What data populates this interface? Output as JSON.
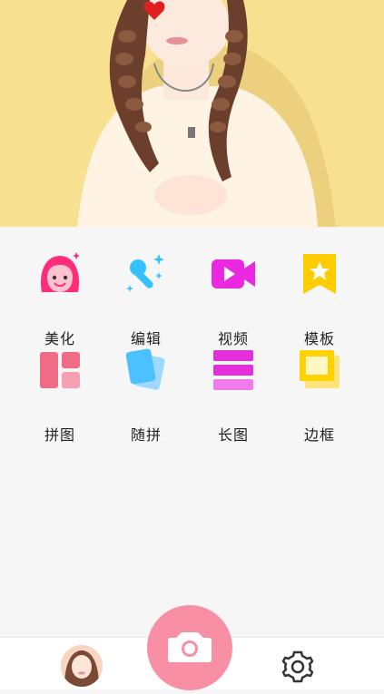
{
  "hero": {
    "banner_name": "photo-banner"
  },
  "tools": [
    {
      "id": "beautify",
      "label": "美化",
      "icon": "face-icon",
      "color": "#ff2d7a"
    },
    {
      "id": "edit",
      "label": "编辑",
      "icon": "magic-wand-icon",
      "color": "#33c2ff"
    },
    {
      "id": "video",
      "label": "视频",
      "icon": "video-camera-icon",
      "color": "#ea28e0"
    },
    {
      "id": "template",
      "label": "模板",
      "icon": "star-bookmark-icon",
      "color": "#ffcc00"
    },
    {
      "id": "collage",
      "label": "拼图",
      "icon": "collage-icon",
      "color": "#f06b86"
    },
    {
      "id": "free-collage",
      "label": "随拼",
      "icon": "cards-icon",
      "color": "#4cc1ff"
    },
    {
      "id": "long-image",
      "label": "长图",
      "icon": "long-image-icon",
      "color": "#e32fdc"
    },
    {
      "id": "frame",
      "label": "边框",
      "icon": "frame-icon",
      "color": "#ffd200"
    }
  ],
  "bottom_nav": {
    "avatar_icon": "avatar",
    "camera_icon": "camera-icon",
    "settings_icon": "gear-icon",
    "camera_color": "#f98fa5"
  }
}
